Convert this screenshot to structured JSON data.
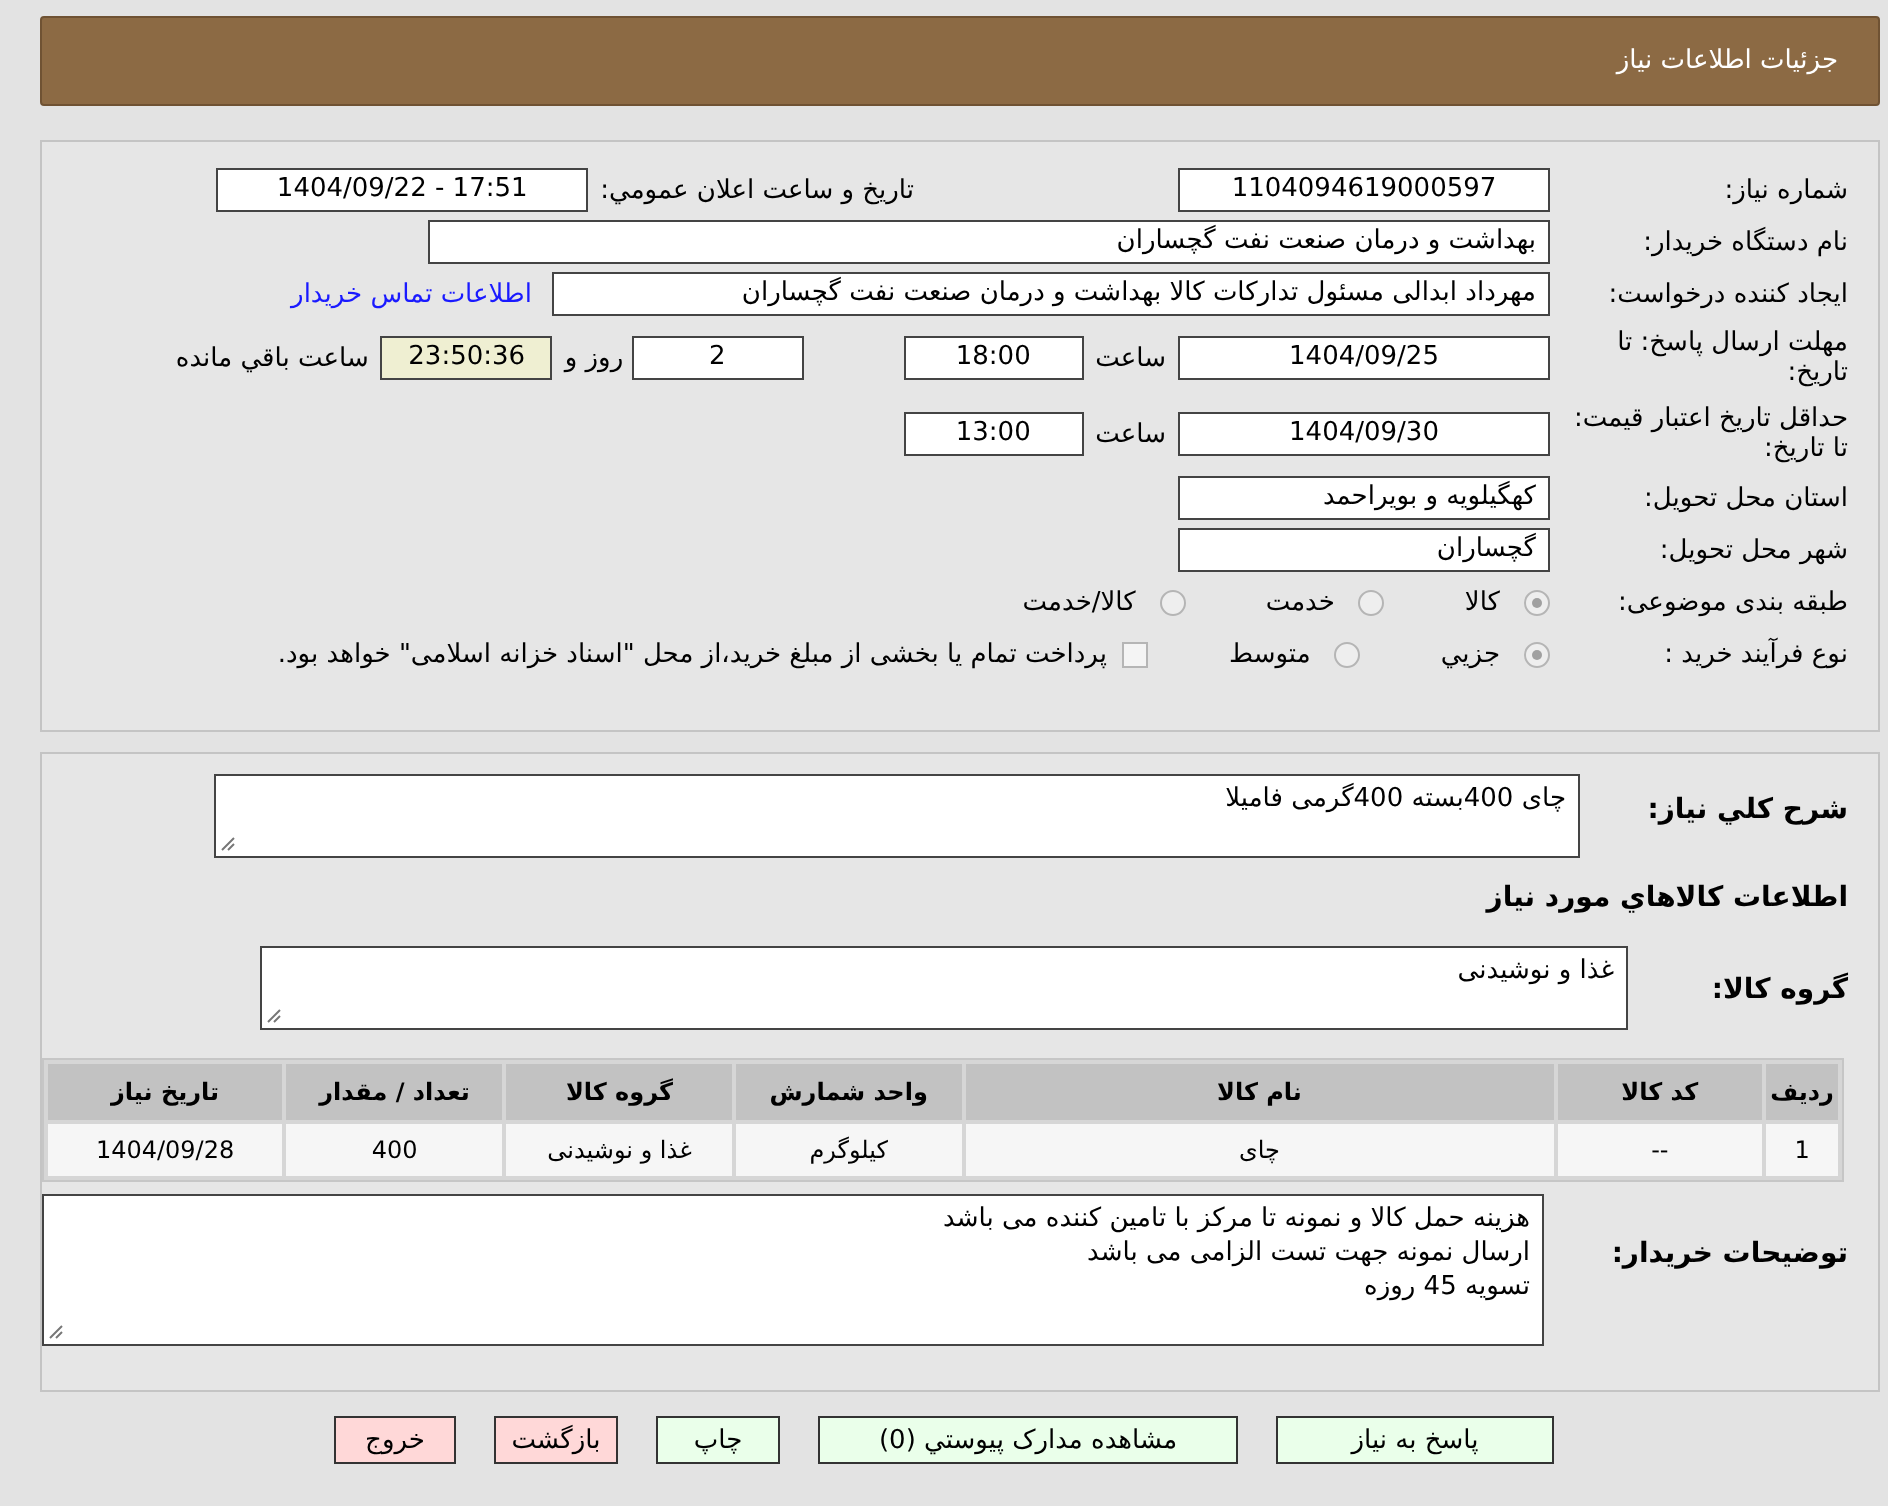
{
  "header": {
    "title": "جزئیات اطلاعات نیاز"
  },
  "need_number": {
    "label": "شماره نیاز:",
    "value": "1104094619000597"
  },
  "announce": {
    "label": "تاریخ و ساعت اعلان عمومي:",
    "value": "1404/09/22 - 17:51"
  },
  "buyer": {
    "label": "نام دستگاه خریدار:",
    "value": "بهداشت و درمان صنعت نفت گچساران"
  },
  "requester": {
    "label": "ایجاد کننده درخواست:",
    "value": "مهرداد ابدالی مسئول تدارکات کالا  بهداشت و درمان صنعت نفت گچساران",
    "link": "اطلاعات تماس خریدار"
  },
  "deadline": {
    "label": "مهلت ارسال پاسخ: تا تاریخ:",
    "date": "1404/09/25",
    "time_label": "ساعت",
    "time": "18:00",
    "days": "2",
    "days_label": "روز و",
    "remaining": "23:50:36",
    "remaining_label": "ساعت باقي مانده"
  },
  "validity": {
    "label": "حداقل تاریخ اعتبار قیمت: تا تاریخ:",
    "date": "1404/09/30",
    "time_label": "ساعت",
    "time": "13:00"
  },
  "province": {
    "label": "استان محل تحویل:",
    "value": "کهگیلویه و بویراحمد"
  },
  "city": {
    "label": "شهر محل تحویل:",
    "value": "گچساران"
  },
  "category": {
    "label": "طبقه بندی موضوعی:",
    "options": [
      {
        "label": "کالا",
        "selected": true
      },
      {
        "label": "خدمت",
        "selected": false
      },
      {
        "label": "کالا/خدمت",
        "selected": false
      }
    ]
  },
  "process": {
    "label": "نوع فرآیند خرید :",
    "options": [
      {
        "label": "جزيي",
        "selected": true
      },
      {
        "label": "متوسط",
        "selected": false
      }
    ],
    "payment": {
      "checked": false,
      "text": "پرداخت تمام یا بخشی از مبلغ خرید،از محل \"اسناد خزانه اسلامی\" خواهد بود."
    }
  },
  "summary": {
    "label": "شرح کلي نیاز:",
    "value": "چای 400بسته 400گرمی فامیلا"
  },
  "goods_heading": "اطلاعات کالاهاي مورد نیاز",
  "goods_group": {
    "label": "گروه کالا:",
    "value": "غذا و نوشیدنی"
  },
  "table": {
    "columns": [
      "ردیف",
      "کد کالا",
      "نام کالا",
      "واحد شمارش",
      "گروه کالا",
      "تعداد / مقدار",
      "تاریخ نیاز"
    ],
    "rows": [
      [
        "1",
        "--",
        "چای",
        "کیلوگرم",
        "غذا و نوشیدنی",
        "400",
        "1404/09/28"
      ]
    ]
  },
  "notes": {
    "label": "توضیحات خریدار:",
    "lines": [
      "هزینه حمل کالا و نمونه تا مرکز با تامین کننده می باشد",
      "ارسال نمونه جهت تست الزامی می باشد",
      "تسویه 45 روزه"
    ]
  },
  "buttons": [
    {
      "label": "پاسخ به نیاز",
      "kind": "ok"
    },
    {
      "label": "مشاهده مدارک پیوستي (0)",
      "kind": "ok"
    },
    {
      "label": "چاپ",
      "kind": "ok"
    },
    {
      "label": "بازگشت",
      "kind": "danger"
    },
    {
      "label": "خروج",
      "kind": "danger"
    }
  ]
}
